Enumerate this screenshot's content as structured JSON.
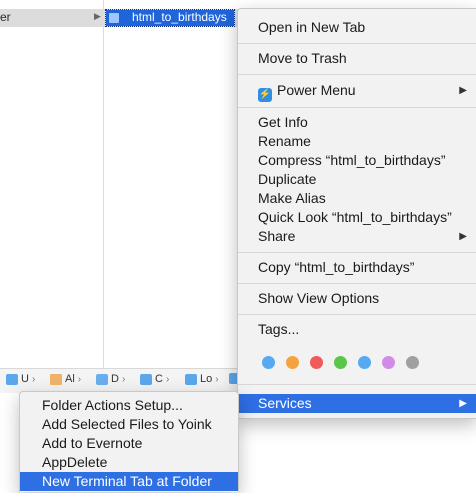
{
  "finder": {
    "top_row_label": "er",
    "selected_item": "html_to_birthdays"
  },
  "pathbar": {
    "crumbs": [
      {
        "label": "U",
        "icon": "user-folder-icon"
      },
      {
        "label": "Al",
        "icon": "home-icon"
      },
      {
        "label": "D",
        "icon": "documents-folder-icon"
      },
      {
        "label": "C",
        "icon": "folder-icon"
      },
      {
        "label": "Lo",
        "icon": "folder-icon"
      },
      {
        "label": "",
        "icon": "folder-icon"
      }
    ]
  },
  "menu": {
    "open_new_tab": "Open in New Tab",
    "move_to_trash": "Move to Trash",
    "power_menu": "Power Menu",
    "get_info": "Get Info",
    "rename": "Rename",
    "compress": "Compress “html_to_birthdays”",
    "duplicate": "Duplicate",
    "make_alias": "Make Alias",
    "quick_look": "Quick Look “html_to_birthdays”",
    "share": "Share",
    "copy": "Copy “html_to_birthdays”",
    "show_view_options": "Show View Options",
    "tags": "Tags...",
    "tag_colors": [
      "#55aaf0",
      "#f4a340",
      "#f05a5a",
      "#5cc54c",
      "#55aaf0",
      "#d18be8",
      "#a0a0a0"
    ],
    "services": "Services"
  },
  "submenu": {
    "items": [
      "Folder Actions Setup...",
      "Add Selected Files to Yoink",
      "Add to Evernote",
      "AppDelete",
      "New Terminal Tab at Folder"
    ]
  },
  "colors": {
    "selection": "#1f64d9",
    "menu_highlight": "#2e6fe4",
    "menu_bg": "#f2f2f2"
  }
}
